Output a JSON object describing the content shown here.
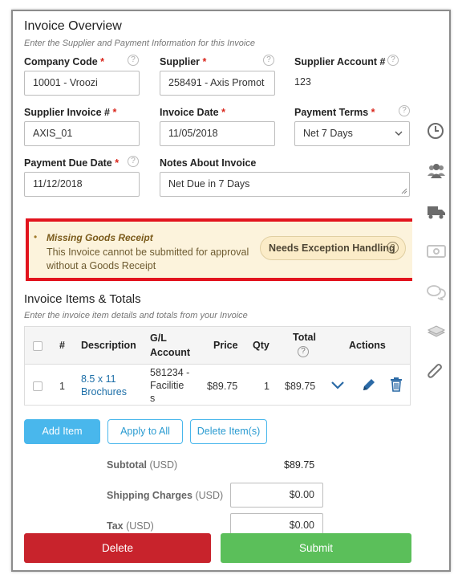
{
  "header": {
    "title": "Invoice Overview",
    "subtitle": "Enter the Supplier and Payment Information for this Invoice"
  },
  "fields": {
    "company_code": {
      "label": "Company Code",
      "value": "10001 - Vroozi"
    },
    "supplier": {
      "label": "Supplier",
      "value": "258491 - Axis Promot"
    },
    "supplier_account": {
      "label": "Supplier Account #",
      "value": "123"
    },
    "supplier_invoice": {
      "label": "Supplier Invoice #",
      "value": "AXIS_01"
    },
    "invoice_date": {
      "label": "Invoice Date",
      "value": "11/05/2018"
    },
    "payment_terms": {
      "label": "Payment Terms",
      "value": "Net 7 Days"
    },
    "payment_due_date": {
      "label": "Payment Due Date",
      "value": "11/12/2018"
    },
    "notes": {
      "label": "Notes About Invoice",
      "value": "Net Due in 7 Days"
    },
    "required_mark": "*",
    "help_mark": "?"
  },
  "alert": {
    "bullet": "•",
    "title": "Missing Goods Receipt",
    "text": "This Invoice cannot be submitted for approval without a Goods Receipt",
    "button_label": "Needs Exception Handling"
  },
  "items": {
    "title": "Invoice Items & Totals",
    "subtitle": "Enter the invoice item details and totals from your Invoice",
    "columns": {
      "num": "#",
      "description": "Description",
      "gl_line1": "G/L",
      "gl_line2": "Account",
      "price": "Price",
      "qty": "Qty",
      "total": "Total",
      "actions": "Actions"
    },
    "rows": [
      {
        "num": "1",
        "description_line1": "8.5 x 11",
        "description_line2": "Brochures",
        "gl_line1": "581234 -",
        "gl_line2": "Facilitie",
        "gl_line3": "s",
        "price": "$89.75",
        "qty": "1",
        "total": "$89.75"
      }
    ]
  },
  "buttons": {
    "add_item": "Add Item",
    "apply_to_all": "Apply to All",
    "delete_items": "Delete Item(s)",
    "delete": "Delete",
    "submit": "Submit"
  },
  "totals": {
    "unit": "(USD)",
    "subtotal_label": "Subtotal",
    "subtotal_value": "$89.75",
    "shipping_label": "Shipping Charges",
    "shipping_value": "$0.00",
    "tax_label": "Tax",
    "tax_value": "$0.00"
  },
  "rail_icons": [
    "clock-icon",
    "users-icon",
    "truck-icon",
    "money-icon",
    "comments-icon",
    "stack-icon",
    "paperclip-icon"
  ],
  "colors": {
    "accent": "#49b7ec",
    "link": "#1d6fa8",
    "danger": "#c8232c",
    "success": "#5bbf5a",
    "alert_border": "#e2141e",
    "alert_bg": "#fcf3dc"
  }
}
